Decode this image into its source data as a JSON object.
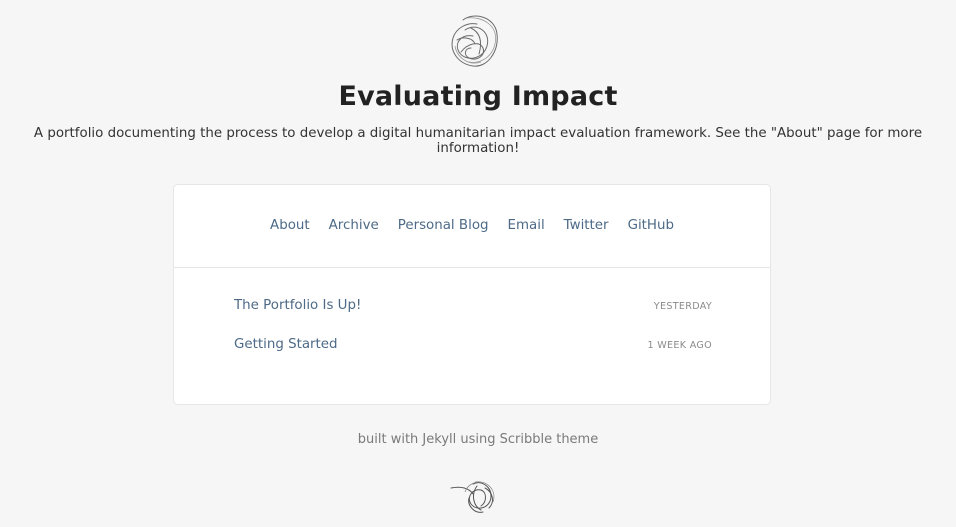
{
  "header": {
    "logo_icon": "scribble-icon",
    "title": "Evaluating Impact",
    "description": "A portfolio documenting the process to develop a digital humanitarian impact evaluation framework. See the \"About\" page for more information!"
  },
  "nav": {
    "items": [
      {
        "label": "About"
      },
      {
        "label": "Archive"
      },
      {
        "label": "Personal Blog"
      },
      {
        "label": "Email"
      },
      {
        "label": "Twitter"
      },
      {
        "label": "GitHub"
      }
    ]
  },
  "posts": [
    {
      "title": "The Portfolio Is Up!",
      "date": "YESTERDAY"
    },
    {
      "title": "Getting Started",
      "date": "1 WEEK AGO"
    }
  ],
  "footer": {
    "credit": "built with Jekyll using Scribble theme",
    "logo_icon": "scribble-icon"
  },
  "colors": {
    "background": "#f6f6f6",
    "link": "#4d6a87",
    "title": "#222222",
    "muted": "#8a8a8a"
  }
}
